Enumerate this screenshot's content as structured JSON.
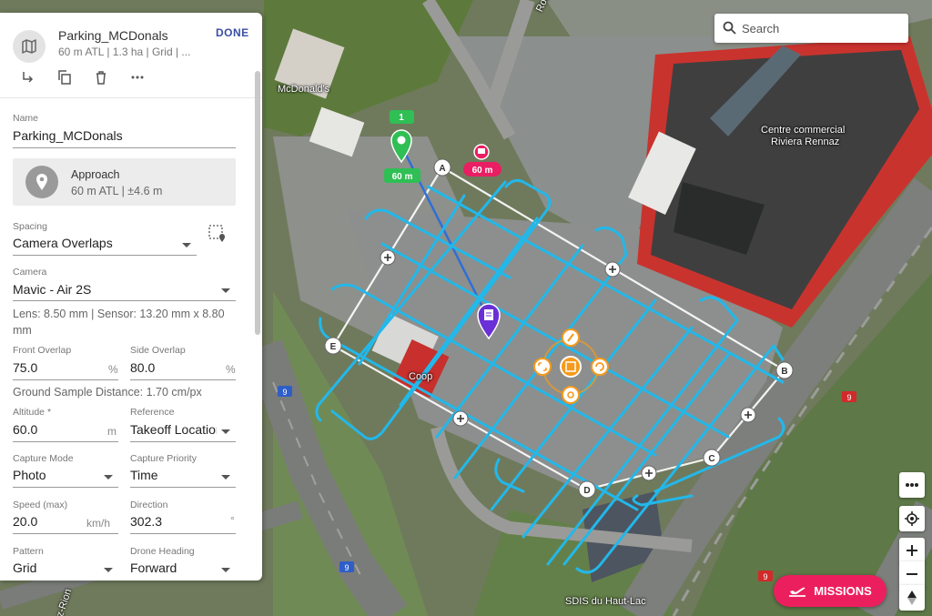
{
  "mission": {
    "title": "Parking_MCDonals",
    "subtitle": "60 m ATL | 1.3 ha | Grid | ...",
    "done_label": "DONE"
  },
  "toolbar_icons": [
    "export-icon",
    "duplicate-icon",
    "delete-icon",
    "more-icon"
  ],
  "form": {
    "name_label": "Name",
    "name_value": "Parking_MCDonals",
    "approach_title": "Approach",
    "approach_detail": "60 m ATL | ±4.6 m",
    "spacing_label": "Spacing",
    "spacing_value": "Camera Overlaps",
    "camera_label": "Camera",
    "camera_value": "Mavic - Air 2S",
    "lens_info_line1": "Lens: 8.50 mm | Sensor: 13.20 mm x 8.80",
    "lens_info_line2": "mm",
    "front_overlap_label": "Front Overlap",
    "front_overlap_value": "75.0",
    "side_overlap_label": "Side Overlap",
    "side_overlap_value": "80.0",
    "percent_unit": "%",
    "gsd_info": "Ground Sample Distance: 1.70 cm/px",
    "altitude_label": "Altitude *",
    "altitude_value": "60.0",
    "altitude_unit": "m",
    "reference_label": "Reference",
    "reference_value": "Takeoff Location",
    "capture_mode_label": "Capture Mode",
    "capture_mode_value": "Photo",
    "capture_priority_label": "Capture Priority",
    "capture_priority_value": "Time",
    "speed_label": "Speed (max)",
    "speed_value": "20.0",
    "speed_unit": "km/h",
    "direction_label": "Direction",
    "direction_value": "302.3",
    "direction_unit": "°",
    "pattern_label": "Pattern",
    "pattern_value": "Grid",
    "drone_heading_label": "Drone Heading",
    "drone_heading_value": "Forward"
  },
  "map": {
    "search_placeholder": "Search",
    "missions_label": "MISSIONS",
    "start_badge": "1",
    "start_altitude": "60 m",
    "home_altitude": "60 m",
    "vertex_labels": [
      "A",
      "B",
      "C",
      "D",
      "E"
    ],
    "place_labels": {
      "mcdonalds": "McDonald's",
      "centre_line1": "Centre commercial",
      "centre_line2": "Riviera Rennaz",
      "coop": "Coop",
      "sdis": "SDIS du Haut-Lac",
      "road_badge": "9",
      "road_top": "Route",
      "road_left": "z-Rion"
    },
    "colors": {
      "flight_path": "#22b8ea",
      "polygon": "#ffffff",
      "start_pin": "#2fbf54",
      "home_pin": "#e91e63",
      "poi_pin": "#6a2fd6",
      "center_tools": "#f59a1d",
      "missions_button": "#ec1f5e",
      "done_text": "#3a4ea6"
    }
  }
}
